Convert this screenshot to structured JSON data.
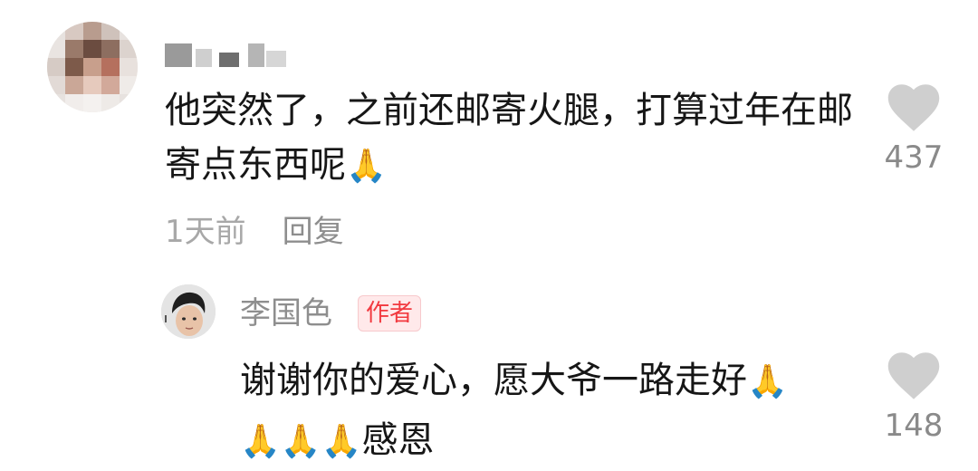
{
  "comment1": {
    "text": "他突然了，之前还邮寄火腿，打算过年在邮寄点东西呢",
    "emoji": "🙏",
    "time": "1天前",
    "reply_label": "回复",
    "like_count": "437"
  },
  "reply1": {
    "author": "李国色",
    "badge": "作者",
    "text": "谢谢你的爱心，愿大爷一路走好",
    "emoji": "🙏",
    "emoji_line": "🙏🙏🙏",
    "suffix": "感恩",
    "like_count": "148"
  },
  "colors": {
    "badge_text": "#f2393f",
    "badge_bg": "#ffe9ea",
    "meta_text": "#a8a8a8",
    "heart_icon": "#cfcfcf"
  }
}
